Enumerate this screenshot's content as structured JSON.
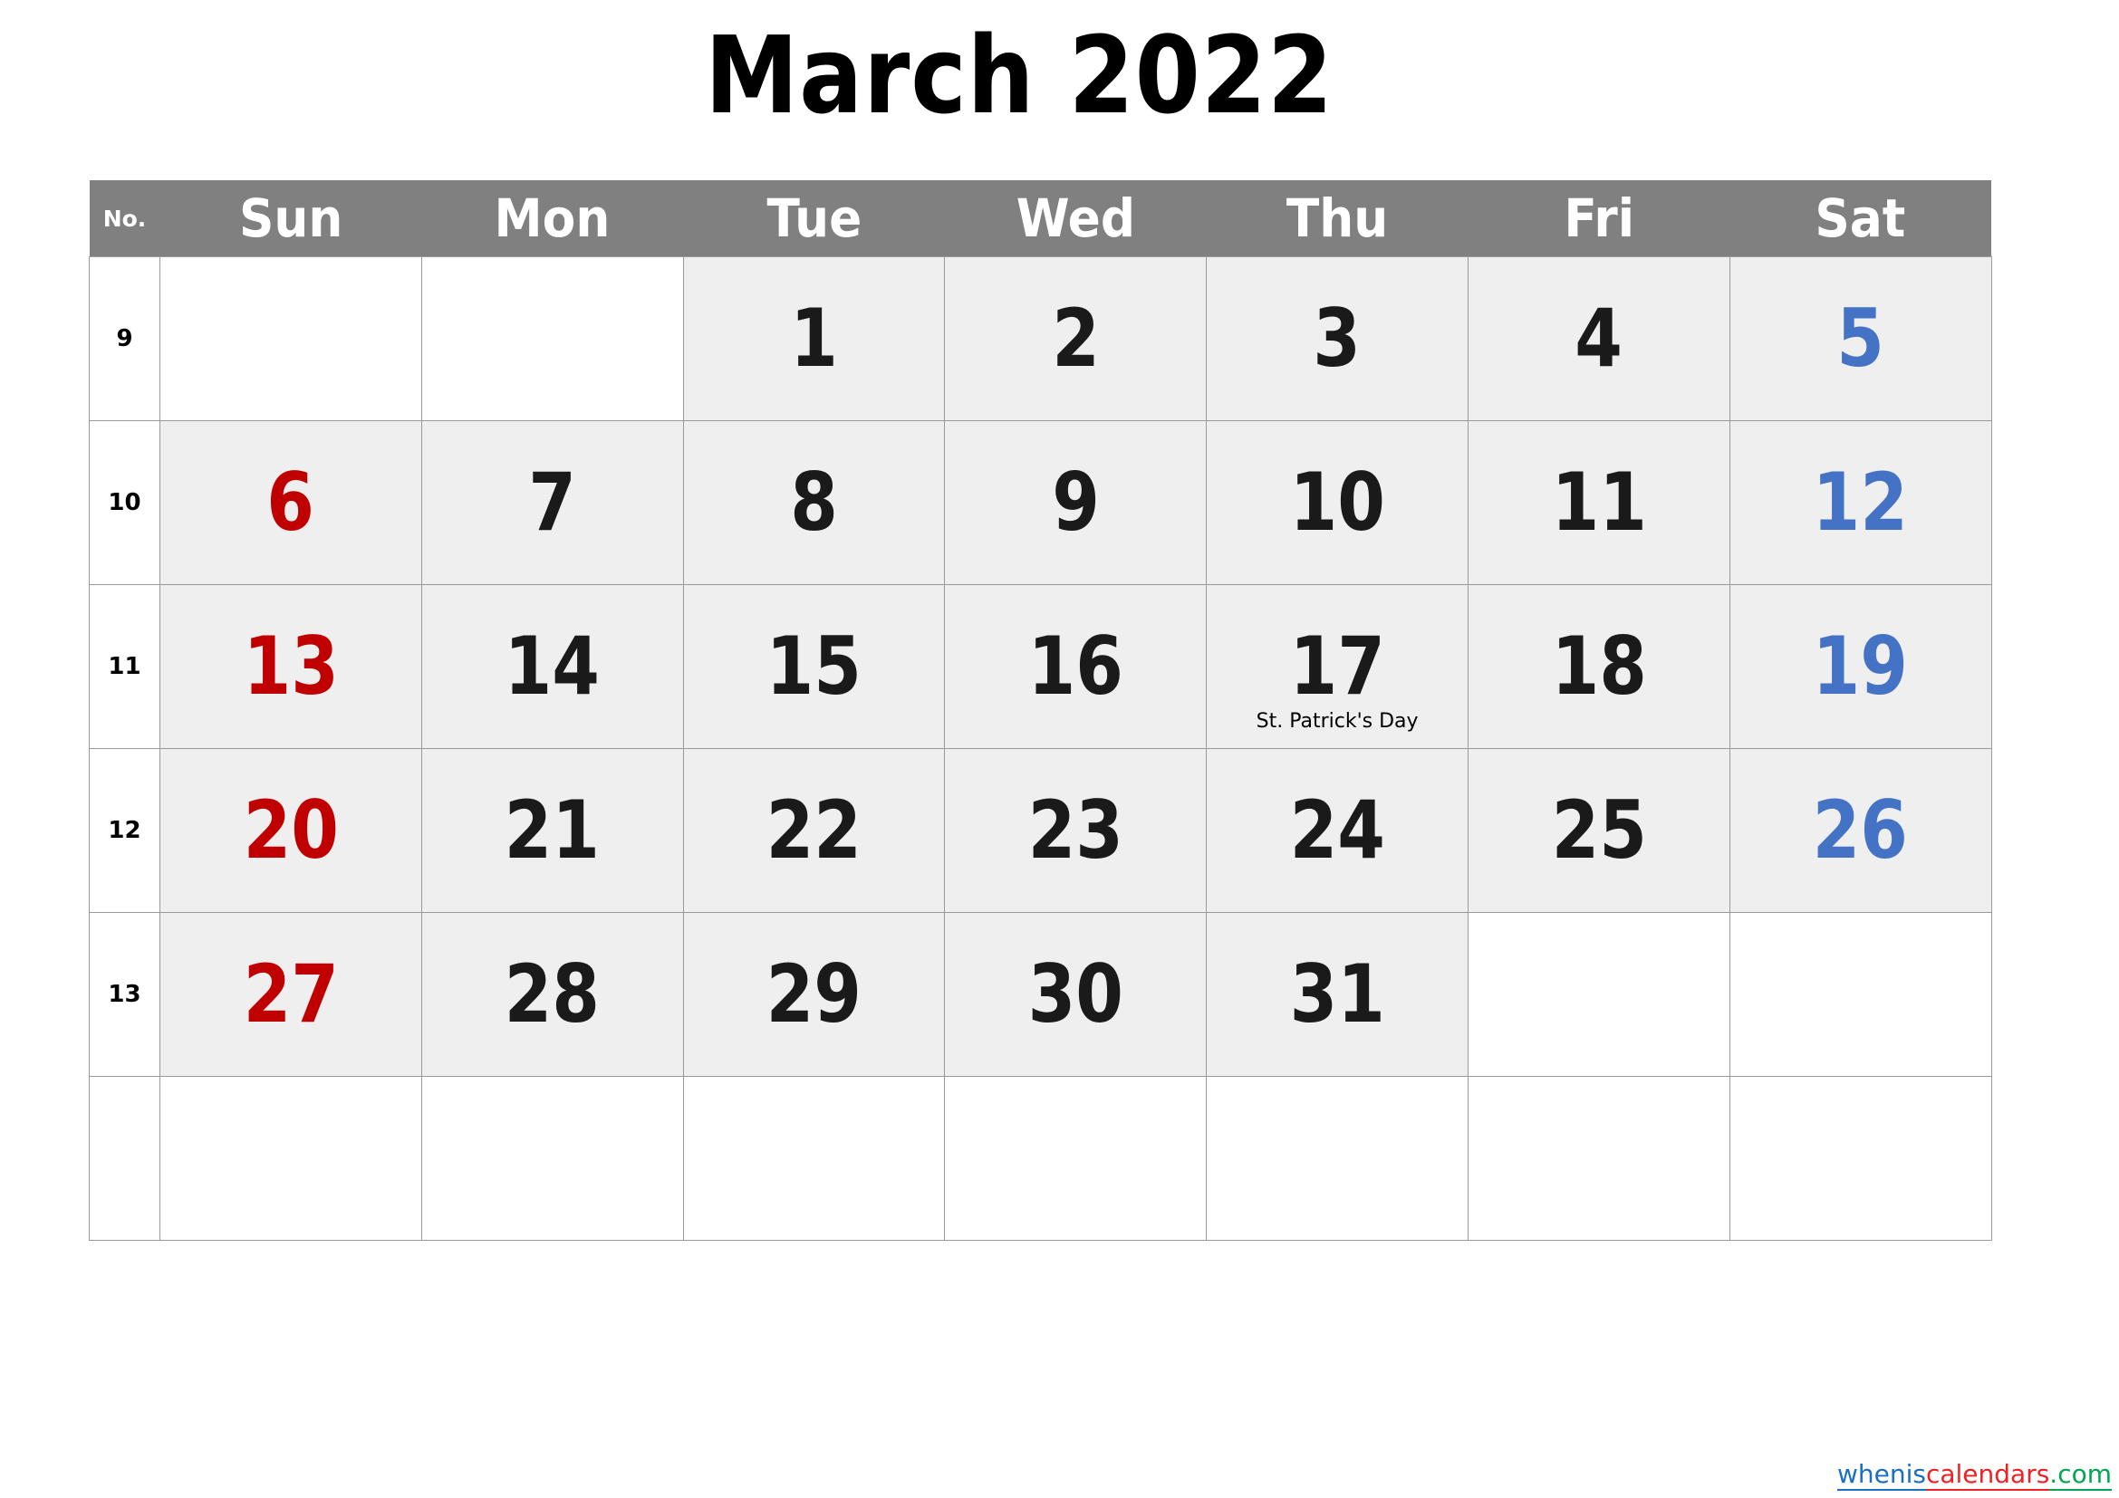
{
  "title": "March 2022",
  "colors": {
    "header_bg": "#808080",
    "header_text": "#ffffff",
    "cell_inmonth_bg": "#efefef",
    "cell_blank_bg": "#ffffff",
    "sunday": "#c00000",
    "saturday": "#4472c4",
    "weekday": "#1a1a1a",
    "border": "#9a9a9a",
    "watermark_blue": "#1a6fc4",
    "watermark_red": "#ee2222",
    "watermark_green": "#00a651"
  },
  "header": {
    "weeknum_label": "No.",
    "days": [
      "Sun",
      "Mon",
      "Tue",
      "Wed",
      "Thu",
      "Fri",
      "Sat"
    ]
  },
  "weeks": [
    {
      "number": "9",
      "days": [
        {
          "date": "",
          "kind": "blank",
          "col": "sun",
          "holiday": ""
        },
        {
          "date": "",
          "kind": "blank",
          "col": "mon",
          "holiday": ""
        },
        {
          "date": "1",
          "kind": "inmonth",
          "col": "tue",
          "holiday": ""
        },
        {
          "date": "2",
          "kind": "inmonth",
          "col": "wed",
          "holiday": ""
        },
        {
          "date": "3",
          "kind": "inmonth",
          "col": "thu",
          "holiday": ""
        },
        {
          "date": "4",
          "kind": "inmonth",
          "col": "fri",
          "holiday": ""
        },
        {
          "date": "5",
          "kind": "inmonth",
          "col": "sat",
          "holiday": ""
        }
      ]
    },
    {
      "number": "10",
      "days": [
        {
          "date": "6",
          "kind": "inmonth",
          "col": "sun",
          "holiday": ""
        },
        {
          "date": "7",
          "kind": "inmonth",
          "col": "mon",
          "holiday": ""
        },
        {
          "date": "8",
          "kind": "inmonth",
          "col": "tue",
          "holiday": ""
        },
        {
          "date": "9",
          "kind": "inmonth",
          "col": "wed",
          "holiday": ""
        },
        {
          "date": "10",
          "kind": "inmonth",
          "col": "thu",
          "holiday": ""
        },
        {
          "date": "11",
          "kind": "inmonth",
          "col": "fri",
          "holiday": ""
        },
        {
          "date": "12",
          "kind": "inmonth",
          "col": "sat",
          "holiday": ""
        }
      ]
    },
    {
      "number": "11",
      "days": [
        {
          "date": "13",
          "kind": "inmonth",
          "col": "sun",
          "holiday": ""
        },
        {
          "date": "14",
          "kind": "inmonth",
          "col": "mon",
          "holiday": ""
        },
        {
          "date": "15",
          "kind": "inmonth",
          "col": "tue",
          "holiday": ""
        },
        {
          "date": "16",
          "kind": "inmonth",
          "col": "wed",
          "holiday": ""
        },
        {
          "date": "17",
          "kind": "inmonth",
          "col": "thu",
          "holiday": "St. Patrick's Day"
        },
        {
          "date": "18",
          "kind": "inmonth",
          "col": "fri",
          "holiday": ""
        },
        {
          "date": "19",
          "kind": "inmonth",
          "col": "sat",
          "holiday": ""
        }
      ]
    },
    {
      "number": "12",
      "days": [
        {
          "date": "20",
          "kind": "inmonth",
          "col": "sun",
          "holiday": ""
        },
        {
          "date": "21",
          "kind": "inmonth",
          "col": "mon",
          "holiday": ""
        },
        {
          "date": "22",
          "kind": "inmonth",
          "col": "tue",
          "holiday": ""
        },
        {
          "date": "23",
          "kind": "inmonth",
          "col": "wed",
          "holiday": ""
        },
        {
          "date": "24",
          "kind": "inmonth",
          "col": "thu",
          "holiday": ""
        },
        {
          "date": "25",
          "kind": "inmonth",
          "col": "fri",
          "holiday": ""
        },
        {
          "date": "26",
          "kind": "inmonth",
          "col": "sat",
          "holiday": ""
        }
      ]
    },
    {
      "number": "13",
      "days": [
        {
          "date": "27",
          "kind": "inmonth",
          "col": "sun",
          "holiday": ""
        },
        {
          "date": "28",
          "kind": "inmonth",
          "col": "mon",
          "holiday": ""
        },
        {
          "date": "29",
          "kind": "inmonth",
          "col": "tue",
          "holiday": ""
        },
        {
          "date": "30",
          "kind": "inmonth",
          "col": "wed",
          "holiday": ""
        },
        {
          "date": "31",
          "kind": "inmonth",
          "col": "thu",
          "holiday": ""
        },
        {
          "date": "",
          "kind": "blank",
          "col": "fri",
          "holiday": ""
        },
        {
          "date": "",
          "kind": "blank",
          "col": "sat",
          "holiday": ""
        }
      ]
    },
    {
      "number": "",
      "days": [
        {
          "date": "",
          "kind": "blank",
          "col": "sun",
          "holiday": ""
        },
        {
          "date": "",
          "kind": "blank",
          "col": "mon",
          "holiday": ""
        },
        {
          "date": "",
          "kind": "blank",
          "col": "tue",
          "holiday": ""
        },
        {
          "date": "",
          "kind": "blank",
          "col": "wed",
          "holiday": ""
        },
        {
          "date": "",
          "kind": "blank",
          "col": "thu",
          "holiday": ""
        },
        {
          "date": "",
          "kind": "blank",
          "col": "fri",
          "holiday": ""
        },
        {
          "date": "",
          "kind": "blank",
          "col": "sat",
          "holiday": ""
        }
      ]
    }
  ],
  "watermark": {
    "part1": "whenis",
    "part2": "calendars",
    "part3": ".com"
  }
}
